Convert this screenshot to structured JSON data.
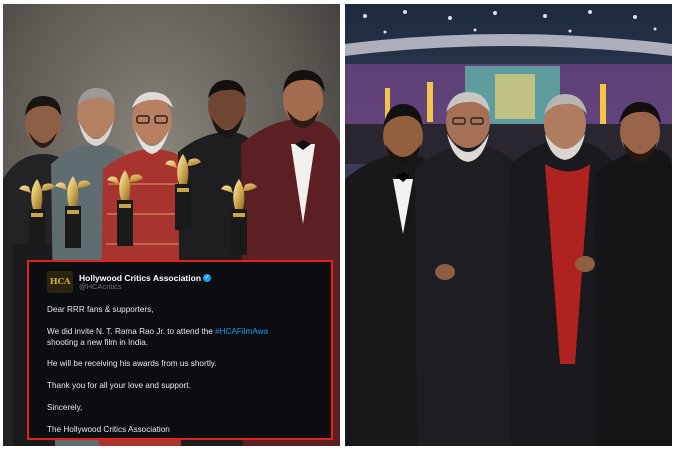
{
  "tweet": {
    "logo_text": "HCA",
    "account_name": "Hollywood Critics Association",
    "handle": "@HCAcritics",
    "greeting": "Dear RRR fans & supporters,",
    "line1_start": "We did invite N. T. Rama Rao Jr. to attend the ",
    "hashtag": "#HCAFilmAwa",
    "line1_cont": "shooting a new film in India.",
    "line2": "He will be receiving his awards from us shortly.",
    "line3": "Thank you for all your love and support.",
    "signoff": "Sincerely,",
    "signature": "The Hollywood Critics Association"
  },
  "colors": {
    "tweet_border": "#e2231a",
    "tweet_background": "#0b0d11",
    "verified_badge": "#1d9bf0",
    "hashtag": "#1d9bf0"
  },
  "icons": {
    "verified": "verified-badge-icon",
    "logo": "hca-logo"
  }
}
